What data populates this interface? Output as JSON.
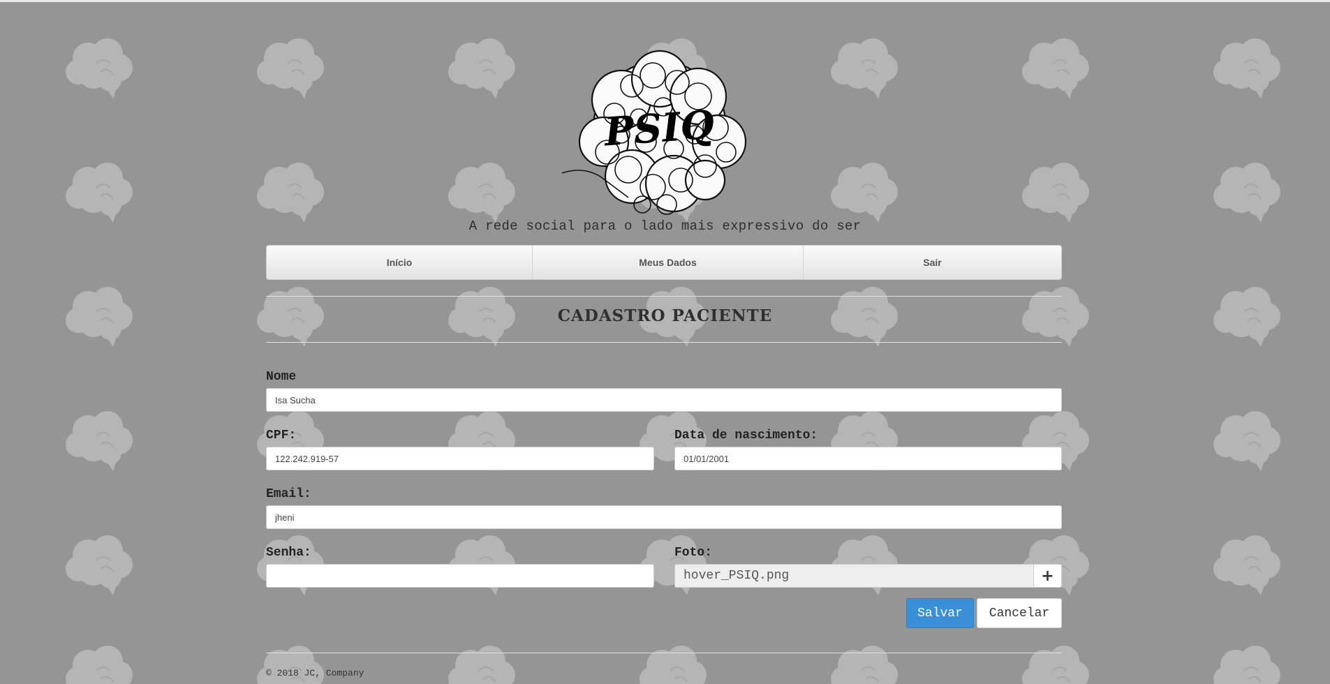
{
  "tagline": "A rede social para o lado mais expressivo do ser",
  "logo": {
    "text": "PSIQ",
    "icon": "brain-scribble-logo"
  },
  "nav": [
    {
      "label": "Início"
    },
    {
      "label": "Meus Dados"
    },
    {
      "label": "Sair"
    }
  ],
  "page_title": "CADASTRO PACIENTE",
  "form": {
    "nome": {
      "label": "Nome",
      "value": "Isa Sucha"
    },
    "cpf": {
      "label": "CPF:",
      "value": "122.242.919-57"
    },
    "nascimento": {
      "label": "Data de nascimento:",
      "value": "01/01/2001"
    },
    "email": {
      "label": "Email:",
      "value": "jheni"
    },
    "senha": {
      "label": "Senha:",
      "value": ""
    },
    "foto": {
      "label": "Foto:",
      "value": "hover_PSIQ.png",
      "add_icon": "plus-icon"
    }
  },
  "buttons": {
    "save": "Salvar",
    "cancel": "Cancelar"
  },
  "footer": "© 2018 JC, Company",
  "colors": {
    "background": "#959595",
    "brain_pattern": "#b5b5b5",
    "primary": "#3a8fd6"
  }
}
